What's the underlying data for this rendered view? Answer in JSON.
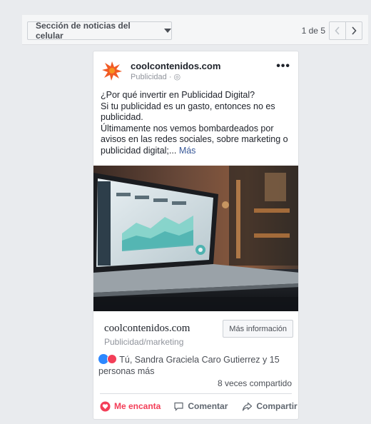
{
  "toolbar": {
    "placement_label": "Sección de noticias del celular",
    "pager_text": "1 de 5"
  },
  "post": {
    "page_name": "coolcontenidos.com",
    "sponsored_label": "Publicidad",
    "text_line1": "¿Por qué invertir en Publicidad Digital?",
    "text_line2": "Si tu publicidad es un gasto, entonces no es publicidad.",
    "text_line3": "Últimamente nos vemos bombardeados por avisos en las redes sociales, sobre marketing o publicidad digital;...",
    "more_label": "Más",
    "link_domain": "coolcontenidos.com",
    "link_category": "Publicidad/marketing",
    "cta_label": "Más información",
    "reactions_text": "Tú, Sandra Graciela Caro Gutierrez y 15 personas más",
    "shares_text": "8 veces compartido"
  },
  "actions": {
    "love_label": "Me encanta",
    "comment_label": "Comentar",
    "share_label": "Compartir"
  },
  "colors": {
    "accent": "#385898",
    "love": "#f33e58",
    "like": "#2d88ff"
  }
}
